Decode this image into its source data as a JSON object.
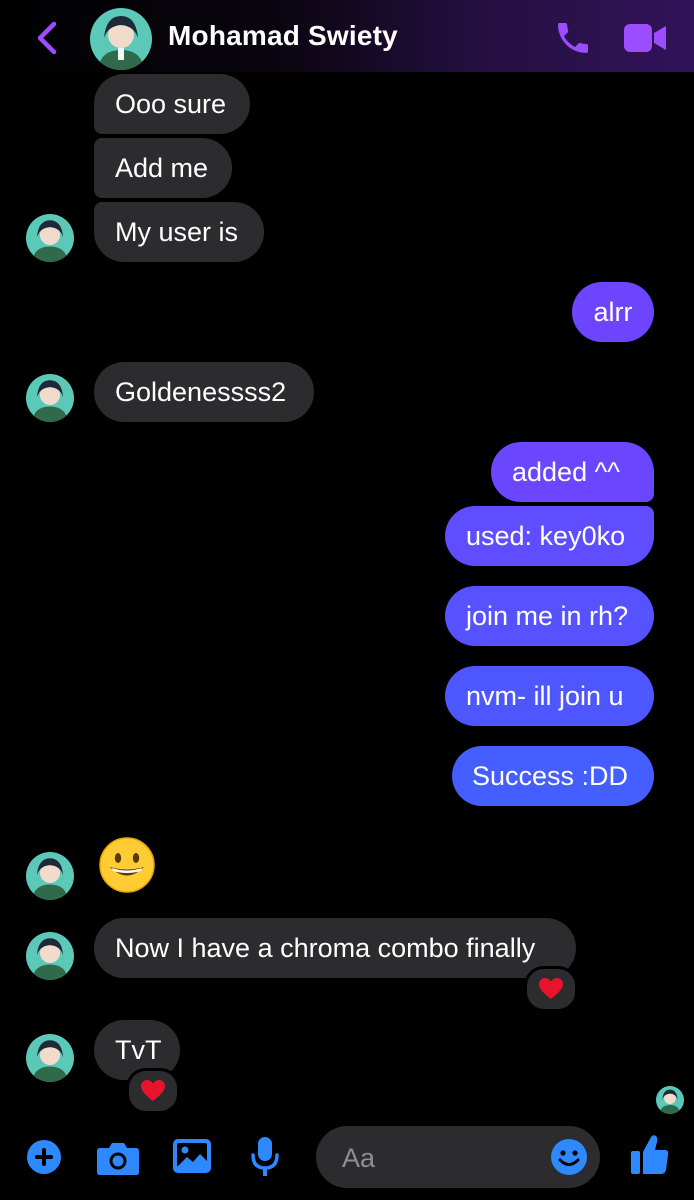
{
  "header": {
    "contact_name": "Mohamad Swiety",
    "icons": [
      "back-chevron-icon",
      "phone-icon",
      "video-camera-icon"
    ],
    "accent_color": "#9b4dff"
  },
  "messages": [
    {
      "side": "incoming",
      "text": "Ooo sure"
    },
    {
      "side": "incoming",
      "text": "Add me"
    },
    {
      "side": "incoming",
      "text": "My user is"
    },
    {
      "side": "outgoing",
      "text": "alrr"
    },
    {
      "side": "incoming",
      "text": "Goldenessss2"
    },
    {
      "side": "outgoing",
      "text": "added ^^"
    },
    {
      "side": "outgoing",
      "text": "used: key0ko"
    },
    {
      "side": "outgoing",
      "text": "join me in rh?"
    },
    {
      "side": "outgoing",
      "text": "nvm- ill join u"
    },
    {
      "side": "outgoing",
      "text": "Success :DD"
    },
    {
      "side": "incoming",
      "emoji": "grinning-face"
    },
    {
      "side": "incoming",
      "text": "Now I have a chroma combo finally",
      "reaction": "red-heart"
    },
    {
      "side": "incoming",
      "text": "TvT",
      "reaction": "red-heart"
    }
  ],
  "composer": {
    "placeholder": "Aa",
    "icons": [
      "plus-icon",
      "camera-icon",
      "photo-icon",
      "microphone-icon",
      "emoji-icon",
      "thumbs-up-icon"
    ],
    "icon_color": "#2e89ff"
  },
  "colors": {
    "incoming_bubble": "#2c2c2e",
    "outgoing_gradient_top": "#7a45ff",
    "outgoing_gradient_bottom": "#3f5cff",
    "background": "#000000"
  }
}
